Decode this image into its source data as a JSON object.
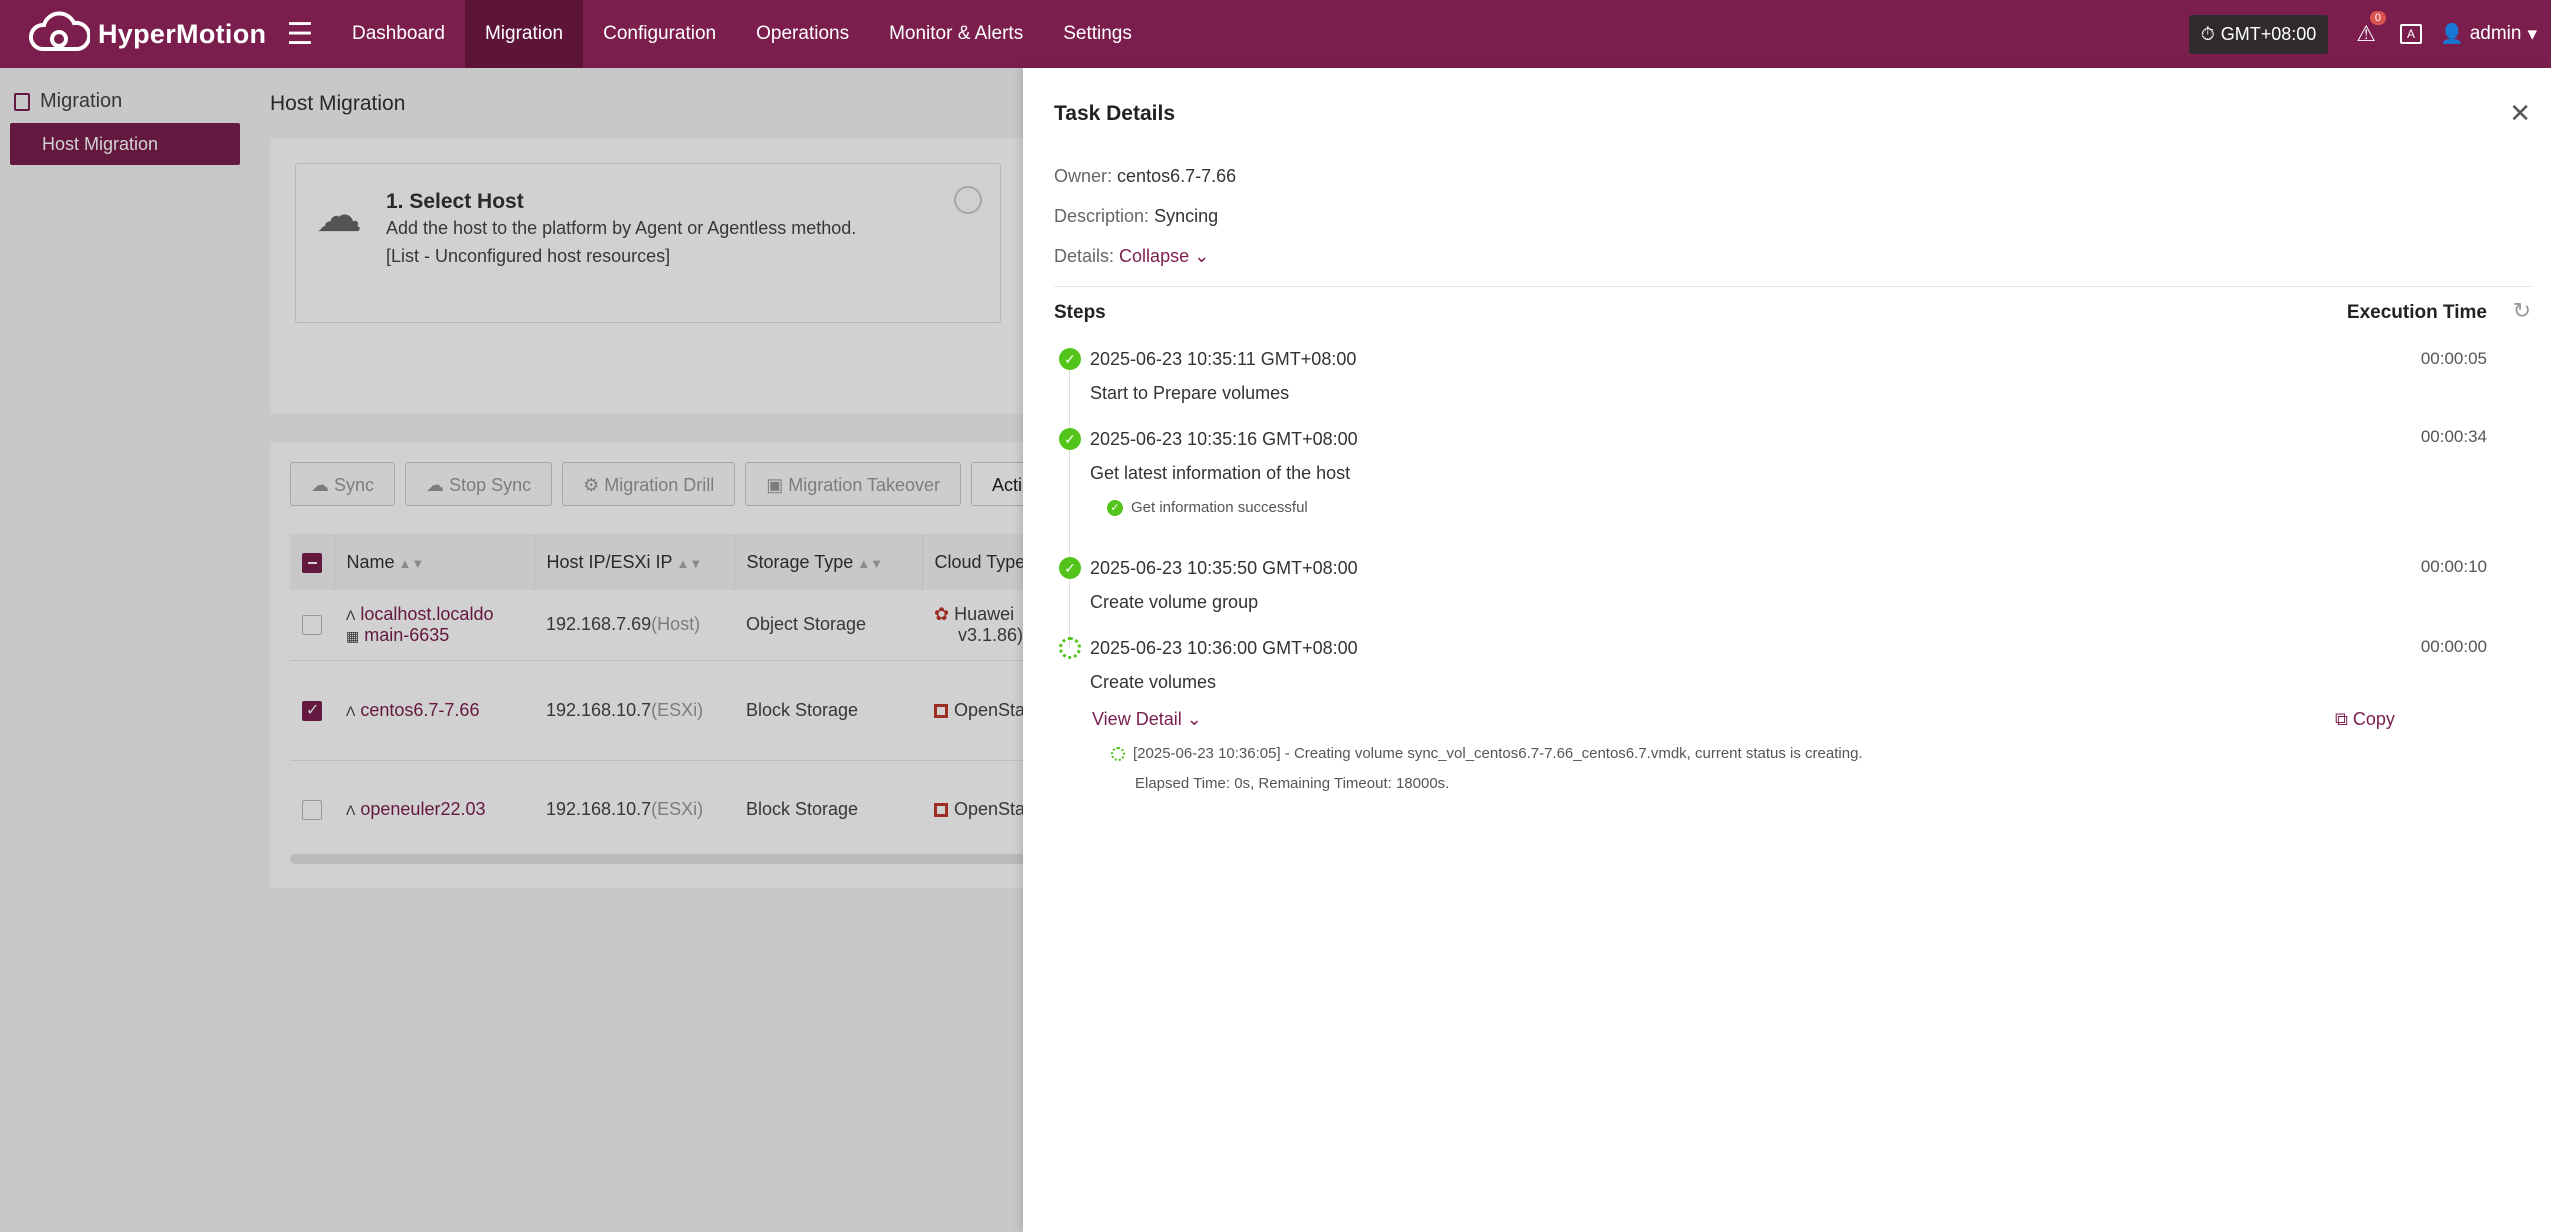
{
  "app": {
    "name": "HyperMotion"
  },
  "nav": [
    "Dashboard",
    "Migration",
    "Configuration",
    "Operations",
    "Monitor & Alerts",
    "Settings"
  ],
  "header": {
    "timezone": "GMT+08:00",
    "alert_count": "0",
    "user": "admin"
  },
  "sidebar": {
    "group": "Migration",
    "active_item": "Host Migration"
  },
  "main": {
    "title": "Host Migration",
    "step": {
      "title": "1. Select Host",
      "line1": "Add the host to the platform by Agent or Agentless method.",
      "line2": "[List - Unconfigured host resources]"
    },
    "toolbar": [
      "Sync",
      "Stop Sync",
      "Migration Drill",
      "Migration Takeover",
      "Acti"
    ],
    "columns": [
      "Name",
      "Host IP/ESXi IP",
      "Storage Type",
      "Cloud Type"
    ],
    "rows": [
      {
        "name1": "localhost.localdo",
        "name2": "main-6635",
        "ip": "192.168.7.69",
        "ip_kind": "(Host)",
        "storage": "Object Storage",
        "cloud1": "Huawei",
        "cloud2": "v3.1.86)"
      },
      {
        "name1": "centos6.7-7.66",
        "ip": "192.168.10.7",
        "ip_kind": "(ESXi)",
        "storage": "Block Storage",
        "cloud1": "OpenSta"
      },
      {
        "name1": "openeuler22.03",
        "ip": "192.168.10.7",
        "ip_kind": "(ESXi)",
        "storage": "Block Storage",
        "cloud1": "OpenSta"
      }
    ]
  },
  "drawer": {
    "title": "Task Details",
    "owner_label": "Owner:",
    "owner": "centos6.7-7.66",
    "desc_label": "Description:",
    "desc": "Syncing",
    "details_label": "Details:",
    "details_toggle": "Collapse",
    "steps_label": "Steps",
    "exec_label": "Execution Time",
    "steps": [
      {
        "time": "2025-06-23 10:35:11 GMT+08:00",
        "name": "Start to Prepare volumes",
        "duration": "00:00:05"
      },
      {
        "time": "2025-06-23 10:35:16 GMT+08:00",
        "name": "Get latest information of the host",
        "duration": "00:00:34",
        "sub": "Get information successful"
      },
      {
        "time": "2025-06-23 10:35:50 GMT+08:00",
        "name": "Create volume group",
        "duration": "00:00:10"
      },
      {
        "time": "2025-06-23 10:36:00 GMT+08:00",
        "name": "Create volumes",
        "duration": "00:00:00"
      }
    ],
    "view_detail": "View Detail",
    "copy": "Copy",
    "log_line1": "[2025-06-23 10:36:05] - Creating volume sync_vol_centos6.7-7.66_centos6.7.vmdk, current status is creating.",
    "log_line2": "Elapsed Time: 0s, Remaining Timeout: 18000s."
  }
}
